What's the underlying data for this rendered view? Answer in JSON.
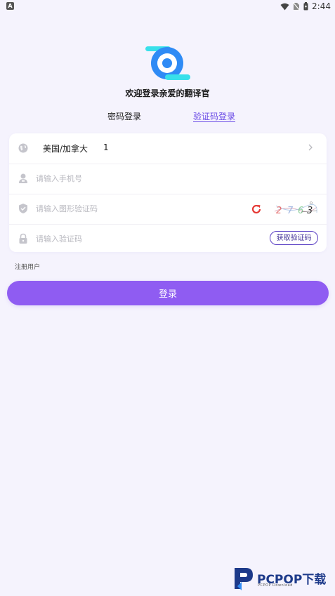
{
  "status_bar": {
    "time": "2:44",
    "indicator": "A"
  },
  "welcome_text": "欢迎登录亲爱的翻译官",
  "tabs": {
    "password": "密码登录",
    "verification": "验证码登录"
  },
  "form": {
    "country_name": "美国/加拿大",
    "country_code": "1",
    "phone_placeholder": "请输入手机号",
    "captcha_placeholder": "请输入图形验证码",
    "captcha_image_text": "2763",
    "code_placeholder": "请输入验证码",
    "get_code_label": "获取验证码"
  },
  "register_label": "注册用户",
  "login_label": "登录",
  "watermark": {
    "brand": "PCPOP下载",
    "sub": "PCPOP Download"
  },
  "colors": {
    "accent": "#8f5cf2",
    "tab_active": "#6c4de6",
    "logo_blue": "#2f8bf5",
    "logo_cyan": "#38e0ea",
    "refresh_red": "#e53935"
  },
  "icons": {
    "country": "globe-icon",
    "phone": "user-icon",
    "captcha": "shield-icon",
    "code": "lock-icon"
  }
}
